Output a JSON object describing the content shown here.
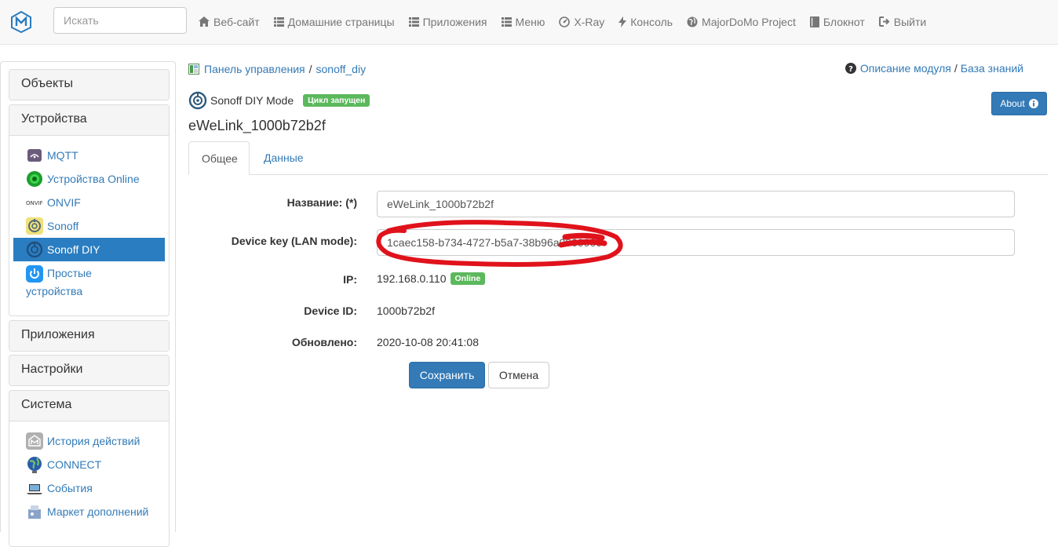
{
  "navbar": {
    "search_placeholder": "Искать",
    "items": [
      {
        "label": "Веб-сайт",
        "icon": "home-icon"
      },
      {
        "label": "Домашние страницы",
        "icon": "list-icon"
      },
      {
        "label": "Приложения",
        "icon": "grid-icon"
      },
      {
        "label": "Меню",
        "icon": "list-icon"
      },
      {
        "label": "X-Ray",
        "icon": "dashboard-icon"
      },
      {
        "label": "Консоль",
        "icon": "flash-icon"
      },
      {
        "label": "MajorDoMo Project",
        "icon": "globe-icon"
      },
      {
        "label": "Блокнот",
        "icon": "book-icon"
      },
      {
        "label": "Выйти",
        "icon": "logout-icon"
      }
    ]
  },
  "sidebar": {
    "objects": "Объекты",
    "devices": "Устройства",
    "device_links": [
      {
        "label": "MQTT",
        "icon": "mqtt-icon"
      },
      {
        "label": "Устройства Online",
        "icon": "online-icon"
      },
      {
        "label": "ONVIF",
        "icon": "onvif-icon"
      },
      {
        "label": "Sonoff",
        "icon": "sonoff-icon"
      },
      {
        "label": "Sonoff DIY",
        "icon": "sonoff-diy-icon"
      }
    ],
    "simple_devices_line1": "Простые",
    "simple_devices_line2": "устройства",
    "apps": "Приложения",
    "settings": "Настройки",
    "system": "Система",
    "system_links": [
      {
        "label": "История действий",
        "icon": "history-icon"
      },
      {
        "label": "CONNECT",
        "icon": "connect-icon"
      },
      {
        "label": "События",
        "icon": "events-icon"
      },
      {
        "label": "Маркет дополнений",
        "icon": "market-icon"
      }
    ]
  },
  "breadcrumb": {
    "root": "Панель управления",
    "separator": "/",
    "current": "sonoff_diy"
  },
  "module_links": {
    "description": "Описание модуля",
    "separator": "/",
    "knowledge": "База знаний"
  },
  "about_label": "About",
  "module": {
    "name": "Sonoff DIY Mode",
    "status": "Цикл запущен"
  },
  "device_title": "eWeLink_1000b72b2f",
  "tabs": {
    "general": "Общее",
    "data": "Данные"
  },
  "form": {
    "name_label": "Название: (*)",
    "name_value": "eWeLink_1000b72b2f",
    "key_label": "Device key (LAN mode):",
    "key_value": "1caec158-b734-4727-b5a7-38b96a0000000",
    "ip_label": "IP:",
    "ip_value": "192.168.0.110",
    "ip_status": "Online",
    "device_id_label": "Device ID:",
    "device_id_value": "1000b72b2f",
    "updated_label": "Обновлено:",
    "updated_value": "2020-10-08 20:41:08",
    "save": "Сохранить",
    "cancel": "Отмена"
  },
  "colors": {
    "link": "#337ab7",
    "primary": "#337ab7",
    "success": "#5cb85c",
    "active_bg": "#2a7dc0",
    "scribble": "#e0121b"
  }
}
